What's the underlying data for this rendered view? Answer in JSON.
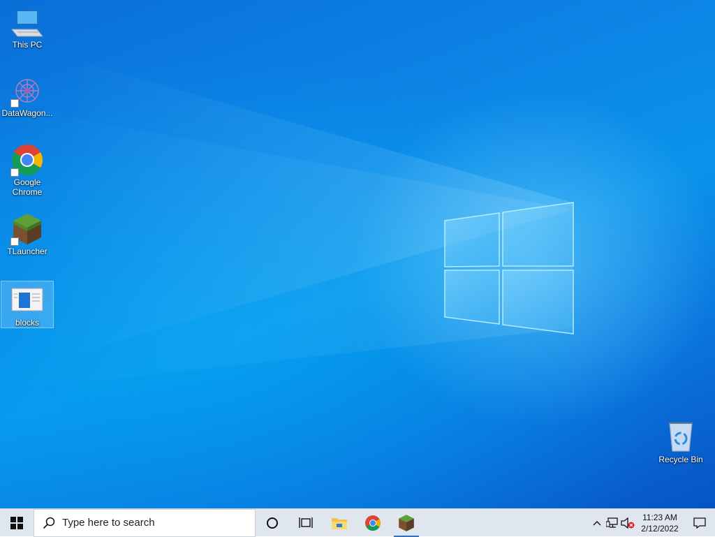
{
  "desktop": {
    "icons": [
      {
        "label": "This PC",
        "icon": "computer-icon",
        "shortcut": false
      },
      {
        "label": "DataWagon...",
        "icon": "datawagon-icon",
        "shortcut": true
      },
      {
        "label": "Google Chrome",
        "icon": "chrome-icon",
        "shortcut": true
      },
      {
        "label": "TLauncher",
        "icon": "minecraft-grass-block-icon",
        "shortcut": true
      },
      {
        "label": "blocks",
        "icon": "document-icon",
        "shortcut": false,
        "selected": true
      }
    ],
    "recycle_bin": {
      "label": "Recycle Bin",
      "icon": "recycle-bin-icon"
    }
  },
  "taskbar": {
    "start_icon": "windows-logo-icon",
    "search_placeholder": "Type here to search",
    "apps": [
      {
        "name": "cortana",
        "icon": "circle-icon"
      },
      {
        "name": "task-view",
        "icon": "task-view-icon"
      },
      {
        "name": "file-explorer",
        "icon": "folder-icon"
      },
      {
        "name": "chrome",
        "icon": "chrome-icon"
      },
      {
        "name": "tlauncher",
        "icon": "minecraft-grass-block-icon",
        "active": true
      }
    ],
    "tray": {
      "icons": [
        "chevron-up-icon",
        "network-icon",
        "volume-muted-icon"
      ],
      "time": "11:23 AM",
      "date": "2/12/2022",
      "notification_icon": "notification-icon"
    }
  },
  "colors": {
    "wallpaper_blue": "#0a86e6",
    "taskbar": "#dfe6ee",
    "active_indicator": "#2b73c9"
  }
}
